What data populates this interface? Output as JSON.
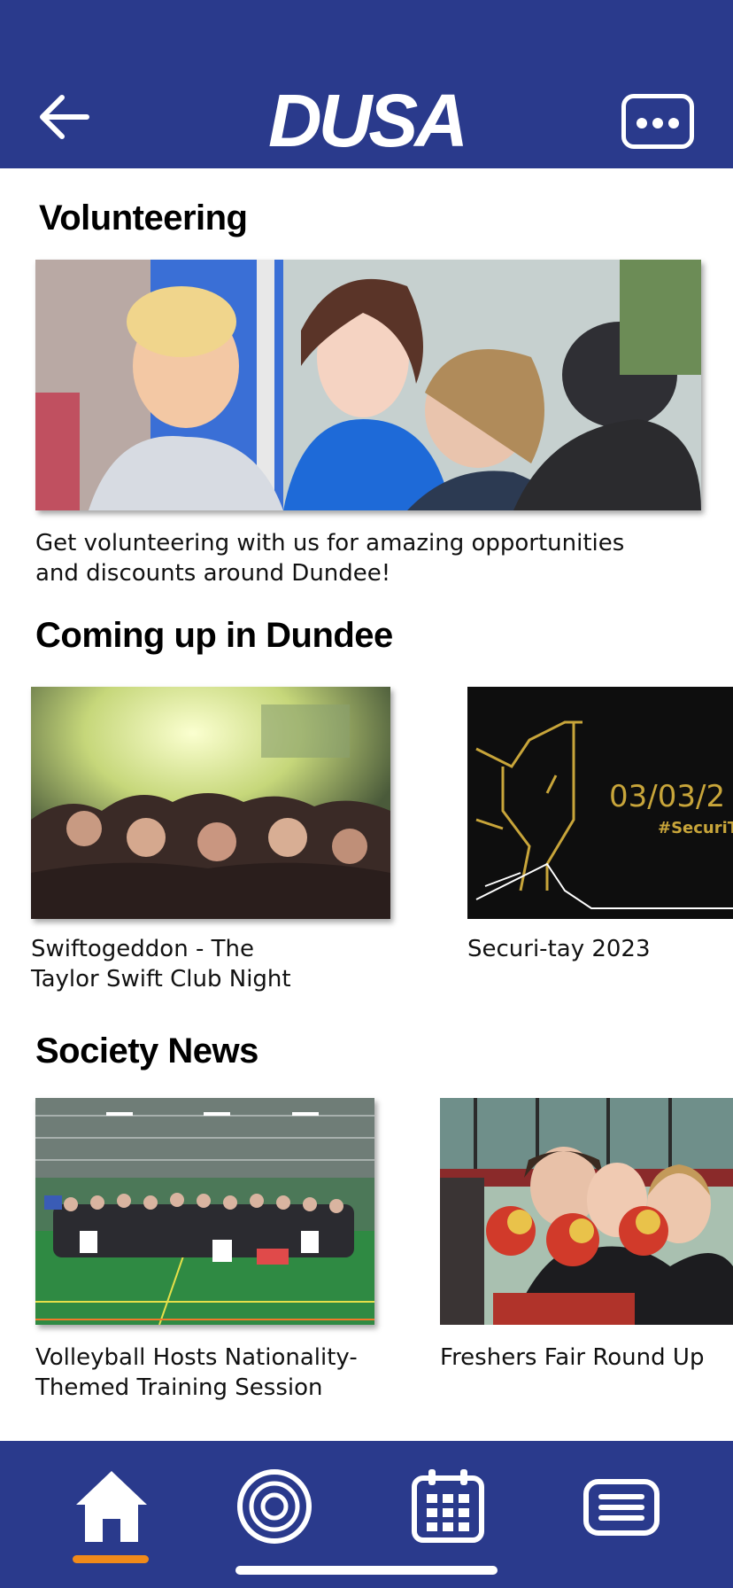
{
  "header": {
    "logo_text": "DUSA",
    "back_icon": "arrow-left-icon",
    "more_icon": "more-dots-icon"
  },
  "volunteering": {
    "title": "Volunteering",
    "description_line1": "Get volunteering with us for amazing opportunities",
    "description_line2": "and discounts around Dundee!"
  },
  "events": {
    "title": "Coming up in Dundee",
    "items": [
      {
        "line1": "Swiftogeddon - The",
        "line2": "Taylor Swift Club Night"
      },
      {
        "line1": "Securi-tay 2023",
        "line2": "",
        "image_text": "03/03/2",
        "image_subtext": "#SecuriT"
      }
    ]
  },
  "news": {
    "title": "Society News",
    "items": [
      {
        "line1": "Volleyball Hosts Nationality-",
        "line2": "Themed Training Session"
      },
      {
        "line1": "Freshers Fair Round Up",
        "line2": ""
      }
    ]
  },
  "bottom_nav": {
    "items": [
      "home-icon",
      "target-icon",
      "calendar-icon",
      "menu-icon"
    ],
    "active": "home-icon"
  },
  "colors": {
    "brand_blue": "#2a3a8c",
    "active_orange": "#f08a1a"
  }
}
